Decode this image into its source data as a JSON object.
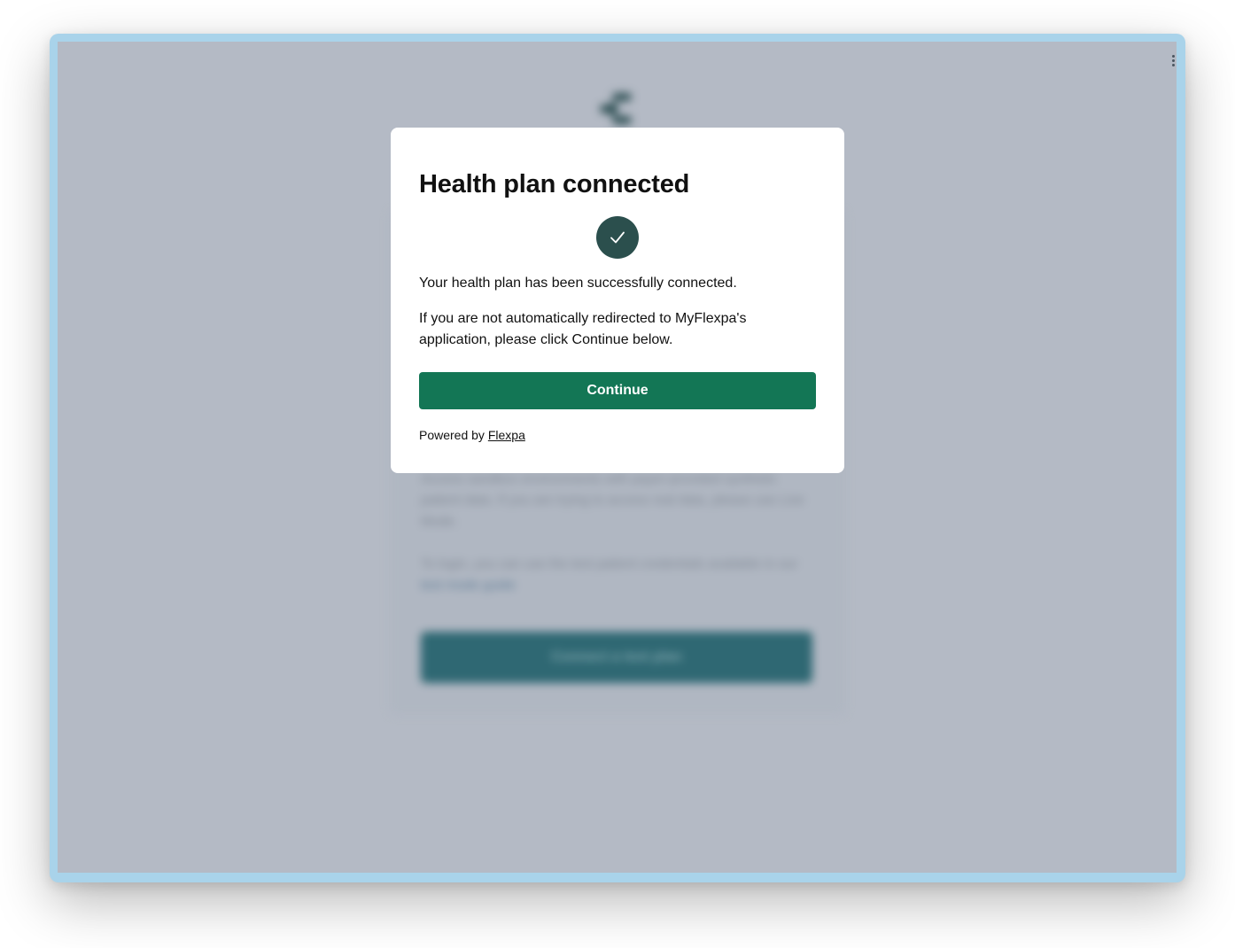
{
  "background": {
    "body_paragraph_1": "Access sandbox environments with payer-provided synthetic patient data. If you are trying to access real data, please use Live Mode.",
    "body_paragraph_2_prefix": "To login, you can use the test patient credentials available in our",
    "body_paragraph_2_link": "test mode guide",
    "connect_button_label": "Connect a test plan"
  },
  "modal": {
    "title": "Health plan connected",
    "success_message": "Your health plan has been successfully connected.",
    "redirect_message": "If you are not automatically redirected to MyFlexpa's application, please click Continue below.",
    "continue_label": "Continue",
    "powered_by_prefix": "Powered by",
    "powered_by_link": "Flexpa"
  },
  "colors": {
    "accent_green": "#137655",
    "check_circle": "#2b4f4d",
    "overlay": "#b4bac5"
  }
}
